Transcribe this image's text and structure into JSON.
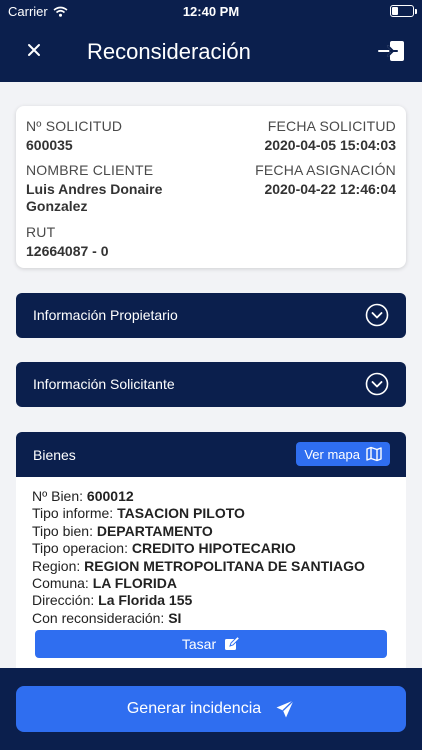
{
  "status_bar": {
    "carrier": "Carrier",
    "time": "12:40 PM"
  },
  "nav": {
    "title": "Reconsideración"
  },
  "summary": {
    "solicitud_label": "Nº SOLICITUD",
    "solicitud_value": "600035",
    "fecha_solicitud_label": "FECHA SOLICITUD",
    "fecha_solicitud_value": "2020-04-05 15:04:03",
    "cliente_label": "NOMBRE CLIENTE",
    "cliente_value_line1": "Luis Andres Donaire",
    "cliente_value_line2": "Gonzalez",
    "fecha_asignacion_label": "FECHA ASIGNACIÓN",
    "fecha_asignacion_value": "2020-04-22 12:46:04",
    "rut_label": "RUT",
    "rut_value": "12664087 - 0"
  },
  "sections": {
    "propietario": "Información Propietario",
    "solicitante": "Información Solicitante"
  },
  "bienes": {
    "title": "Bienes",
    "map_button": "Ver mapa",
    "lines": [
      {
        "label": "Nº Bien:",
        "value": "600012"
      },
      {
        "label": "Tipo informe:",
        "value": "TASACION PILOTO"
      },
      {
        "label": "Tipo bien:",
        "value": "DEPARTAMENTO"
      },
      {
        "label": "Tipo operacion:",
        "value": "CREDITO HIPOTECARIO"
      },
      {
        "label": "Region:",
        "value": "REGION METROPOLITANA DE SANTIAGO"
      },
      {
        "label": "Comuna:",
        "value": "LA FLORIDA"
      },
      {
        "label": "Dirección:",
        "value": "La Florida 155"
      },
      {
        "label": "Con reconsideración:",
        "value": "SI"
      }
    ],
    "tasar_button": "Tasar"
  },
  "footer": {
    "generar_button": "Generar incidencia"
  },
  "colors": {
    "navy": "#0b1f4d",
    "accent_blue": "#2f6ef0",
    "background": "#f2f3f6"
  }
}
